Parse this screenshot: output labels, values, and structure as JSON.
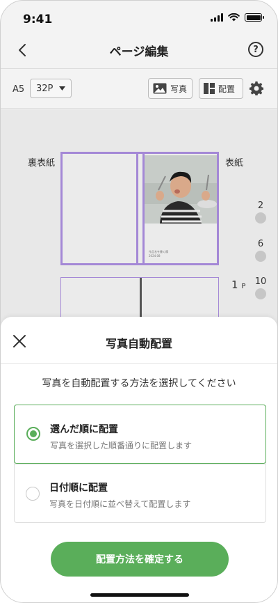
{
  "status_bar": {
    "time": "9:41"
  },
  "nav": {
    "title": "ページ編集"
  },
  "toolbar": {
    "size_label": "A5",
    "page_count": "32P",
    "photo_label": "写真",
    "layout_label": "配置"
  },
  "canvas": {
    "back_cover_label": "裏表紙",
    "front_cover_label": "表紙",
    "cover_caption_line1": "作品名を書く欄",
    "cover_caption_line2": "2024.08",
    "page_numbers": [
      "2",
      "6",
      "10"
    ],
    "current_page": "1",
    "current_page_suffix": "P"
  },
  "sheet": {
    "title": "写真自動配置",
    "description": "写真を自動配置する方法を選択してください",
    "options": [
      {
        "title": "選んだ順に配置",
        "subtitle": "写真を選択した順番通りに配置します",
        "selected": true
      },
      {
        "title": "日付順に配置",
        "subtitle": "写真を日付順に並べ替えて配置します",
        "selected": false
      }
    ],
    "confirm_label": "配置方法を確定する"
  },
  "colors": {
    "accent": "#5aae5a",
    "selection_border": "#a488d6"
  }
}
